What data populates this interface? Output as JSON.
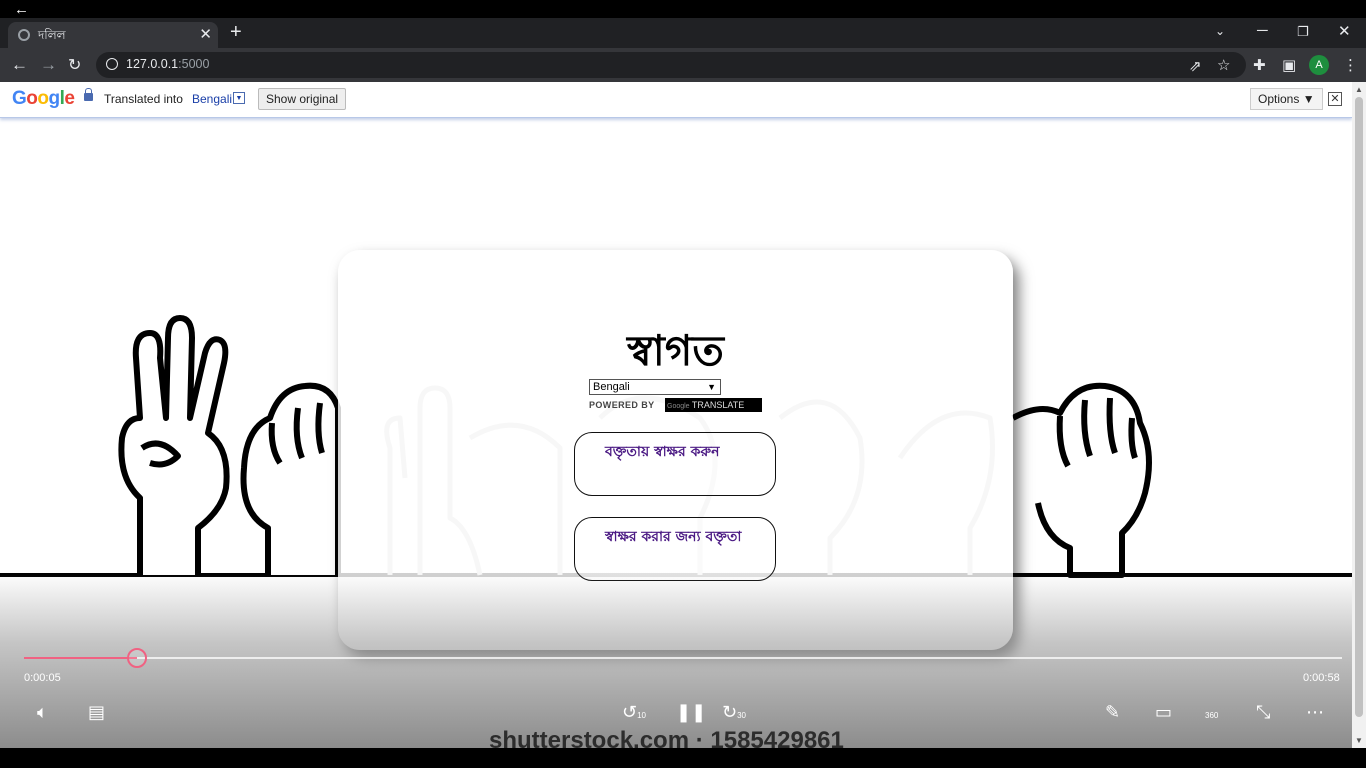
{
  "player": {
    "back_glyph": "←"
  },
  "browser": {
    "tab_title": "দলিল",
    "tab_close": "✕",
    "new_tab": "+",
    "url_host": "127.0.0.1",
    "url_port": ":5000",
    "profile_initial": "A"
  },
  "translate_bar": {
    "logo": "Google",
    "translated_into": "Translated into",
    "language": "Bengali",
    "show_original": "Show original",
    "options": "Options ▼",
    "close": "✕"
  },
  "card": {
    "welcome": "স্বাগত",
    "language_select": "Bengali",
    "powered_by": "POWERED BY",
    "powered_badge_google": "Google",
    "powered_badge_translate": "TRANSLATE",
    "button1": "বক্তৃতায় স্বাক্ষর করুন",
    "button2": "স্বাক্ষর করার জন্য বক্তৃতা"
  },
  "video": {
    "elapsed": "0:00:05",
    "duration": "0:00:58",
    "progress": 0.086,
    "skip_back": "10",
    "skip_forward": "30",
    "view_360": "360",
    "watermark": "shutterstock.com · 1585429861"
  },
  "colors": {
    "accent": "#f06282",
    "button_text": "#4b1a84",
    "translate_link": "#1a3fa8"
  }
}
